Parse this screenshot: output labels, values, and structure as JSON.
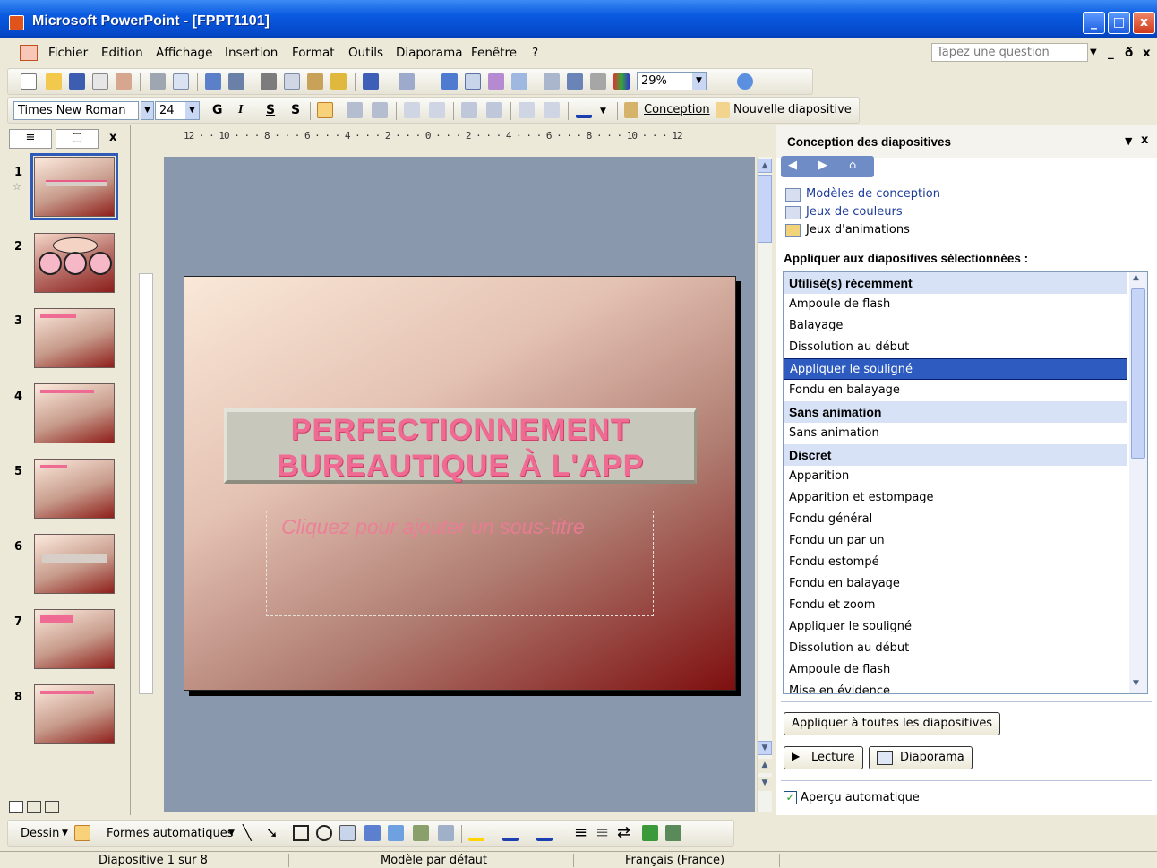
{
  "window": {
    "title": "Microsoft PowerPoint - [FPPT1101]",
    "minimize": "_",
    "maximize": "□",
    "close": "x"
  },
  "menu": {
    "items": [
      "Fichier",
      "Edition",
      "Affichage",
      "Insertion",
      "Format",
      "Outils",
      "Diaporama",
      "Fenêtre",
      "?"
    ],
    "question_placeholder": "Tapez une question",
    "doc_controls": [
      "_",
      "ð",
      "x"
    ]
  },
  "toolbar_standard": {
    "zoom": "29%"
  },
  "toolbar_format": {
    "font": "Times New Roman",
    "size": "24",
    "bold": "G",
    "italic": "I",
    "underline": "S",
    "shadow": "S",
    "design_label": "Conception",
    "new_slide_label": "Nouvelle diapositive"
  },
  "slide_panel": {
    "close": "x",
    "thumbnails": [
      "1",
      "2",
      "3",
      "4",
      "5",
      "6",
      "7",
      "8"
    ]
  },
  "ruler": {
    "h_text": "12 · · 10 · · · 8 · · · 6 · · · 4 · · · 2 · · · 0 · · · 2 · · · 4 · · · 6 · · · 8 · · · 10 · · · 12"
  },
  "slide": {
    "title_line1": "PERFECTIONNEMENT",
    "title_line2": "BUREAUTIQUE À L'APP",
    "subtitle_placeholder": "Cliquez pour ajouter un sous-titre"
  },
  "task_pane": {
    "title": "Conception des diapositives",
    "links": [
      "Modèles de conception",
      "Jeux de couleurs",
      "Jeux d'animations"
    ],
    "apply_label": "Appliquer aux diapositives sélectionnées :",
    "list": [
      {
        "label": "Utilisé(s) récemment",
        "type": "group"
      },
      {
        "label": "Ampoule de flash",
        "type": "item"
      },
      {
        "label": "Balayage",
        "type": "item"
      },
      {
        "label": "Dissolution au début",
        "type": "item"
      },
      {
        "label": "Appliquer le souligné",
        "type": "selected"
      },
      {
        "label": "Fondu en balayage",
        "type": "item"
      },
      {
        "label": "Sans animation",
        "type": "group"
      },
      {
        "label": "Sans animation",
        "type": "item"
      },
      {
        "label": "Discret",
        "type": "group"
      },
      {
        "label": "Apparition",
        "type": "item"
      },
      {
        "label": "Apparition et estompage",
        "type": "item"
      },
      {
        "label": "Fondu général",
        "type": "item"
      },
      {
        "label": "Fondu un par un",
        "type": "item"
      },
      {
        "label": "Fondu estompé",
        "type": "item"
      },
      {
        "label": "Fondu en balayage",
        "type": "item"
      },
      {
        "label": "Fondu et zoom",
        "type": "item"
      },
      {
        "label": "Appliquer le souligné",
        "type": "item"
      },
      {
        "label": "Dissolution au début",
        "type": "item"
      },
      {
        "label": "Ampoule de flash",
        "type": "item"
      },
      {
        "label": "Mise en évidence",
        "type": "item"
      }
    ],
    "apply_all_button": "Appliquer à toutes les diapositives",
    "play_button": "Lecture",
    "slideshow_button": "Diaporama",
    "autopreview_label": "Aperçu automatique"
  },
  "drawing_toolbar": {
    "draw_label": "Dessin",
    "autoshapes_label": "Formes automatiques"
  },
  "status": {
    "slide": "Diapositive 1 sur 8",
    "template": "Modèle par défaut",
    "language": "Français (France)"
  },
  "colors": {
    "title_bar": "#0a5ae0",
    "title_text": "#f06b93",
    "selection": "#2d5bc0"
  }
}
